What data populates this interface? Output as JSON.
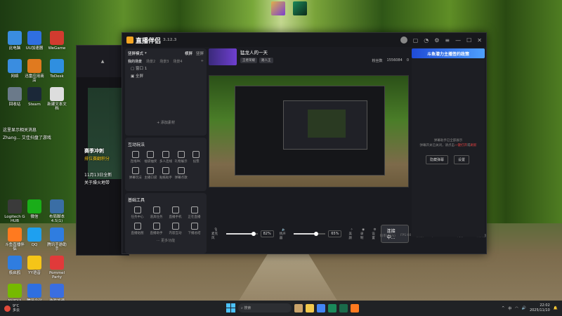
{
  "app": {
    "title": "直播伴侣",
    "version": "3.12.3",
    "window_controls": [
      "minimize",
      "maximize",
      "close"
    ]
  },
  "left_panel": {
    "mode_label": "竖屏模式",
    "orientation_tabs": [
      "横屏",
      "竖屏"
    ],
    "scene_label": "我的场景",
    "scene_tabs": [
      "我的场景",
      "场景2",
      "场景3",
      "场景4"
    ],
    "scenes": [
      "窗口 1",
      "全屏"
    ],
    "add_source": "+ 添加素材",
    "interact_title": "互动玩法",
    "interact_items": [
      "连线PK",
      "福袋抽奖",
      "多人连线",
      "礼物展示",
      "投票",
      "弹幕玩法",
      "主播口袋",
      "贴纸助手",
      "弹幕点歌"
    ],
    "tools_title": "基础工具",
    "tools_items": [
      "任务中心",
      "道具任务",
      "直播手机",
      "正在直播",
      "直播贴图",
      "直播助手",
      "内容互动",
      "下播总结"
    ],
    "more": "··· 更多功能"
  },
  "stream": {
    "name": "猛龙人的一天",
    "tags": [
      "王者荣耀",
      "路人王"
    ],
    "status_fans": "粉丝数",
    "count1": "1556084",
    "count2": "0"
  },
  "controls": {
    "mic_label": "麦克风",
    "mic_pct": "82%",
    "mic_level": 0.82,
    "spk_label": "扬声器",
    "spk_pct": "65%",
    "spk_level": 0.65,
    "btn_effect": "美颜",
    "btn_record": "录制",
    "btn_settings": "设置",
    "go_live": "连接中..."
  },
  "statusbar": [
    "码率(Kb/s)",
    "FPS:60",
    "丢帧(0.0%)",
    "CPU:24%",
    "内存:21%",
    "未开播"
  ],
  "right_panel": {
    "banner": "斗鱼潜力主播签约政策",
    "message_line1": "弹幕助手已全部展示",
    "message_line2": "弹幕开关已关闭，请点击",
    "message_link": "一键打开",
    "message_and": "或",
    "message_link2": "刷新",
    "btn1": "隐藏弹幕",
    "btn2": "设置"
  },
  "overlay_text": {
    "line1": "这里显示相关消息",
    "line2": "Zhang... 艾佳扫盘了游戏",
    "line3": "赛季冲刺",
    "line4": "排位赛翻积分",
    "line5": "11月13日全新",
    "line6": "关于燥火地带"
  },
  "desktop_icons": [
    {
      "label": "此电脑",
      "color": "#3a8de0"
    },
    {
      "label": "UU加速器",
      "color": "#2f6fe0"
    },
    {
      "label": "WeGame",
      "color": "#d23b2f"
    },
    {
      "label": "网络",
      "color": "#3a8de0"
    },
    {
      "label": "迅雷应用商店",
      "color": "#e07a1f"
    },
    {
      "label": "ToDesk",
      "color": "#2f8fe0"
    },
    {
      "label": "回收站",
      "color": "#6b7a8a"
    },
    {
      "label": "Steam",
      "color": "#1b2838"
    },
    {
      "label": "新建文本文档",
      "color": "#dddddd"
    },
    {
      "label": "Logitech G HUB",
      "color": "#3a3a3a"
    },
    {
      "label": "微信",
      "color": "#1aad19"
    },
    {
      "label": "布局脚本 4.5(1)",
      "color": "#3a6ea5"
    },
    {
      "label": "斗鱼直播伴侣",
      "color": "#ff7a1f"
    },
    {
      "label": "QQ",
      "color": "#1ea0f0"
    },
    {
      "label": "腾讯手游助手",
      "color": "#2f7de0"
    },
    {
      "label": "极启鸥",
      "color": "#2f7de0"
    },
    {
      "label": "YY语音",
      "color": "#f5c518"
    },
    {
      "label": "Pommel Party",
      "color": "#e03a3a"
    },
    {
      "label": "NVIDIA App",
      "color": "#76b900"
    },
    {
      "label": "腾讯会议",
      "color": "#2f6fe0"
    },
    {
      "label": "游戏加速",
      "color": "#3a6ee0"
    }
  ],
  "taskbar": {
    "weather_temp": "9°C",
    "weather_desc": "多云",
    "search_placeholder": "搜索",
    "time": "22:02",
    "date": "2025/11/10"
  }
}
